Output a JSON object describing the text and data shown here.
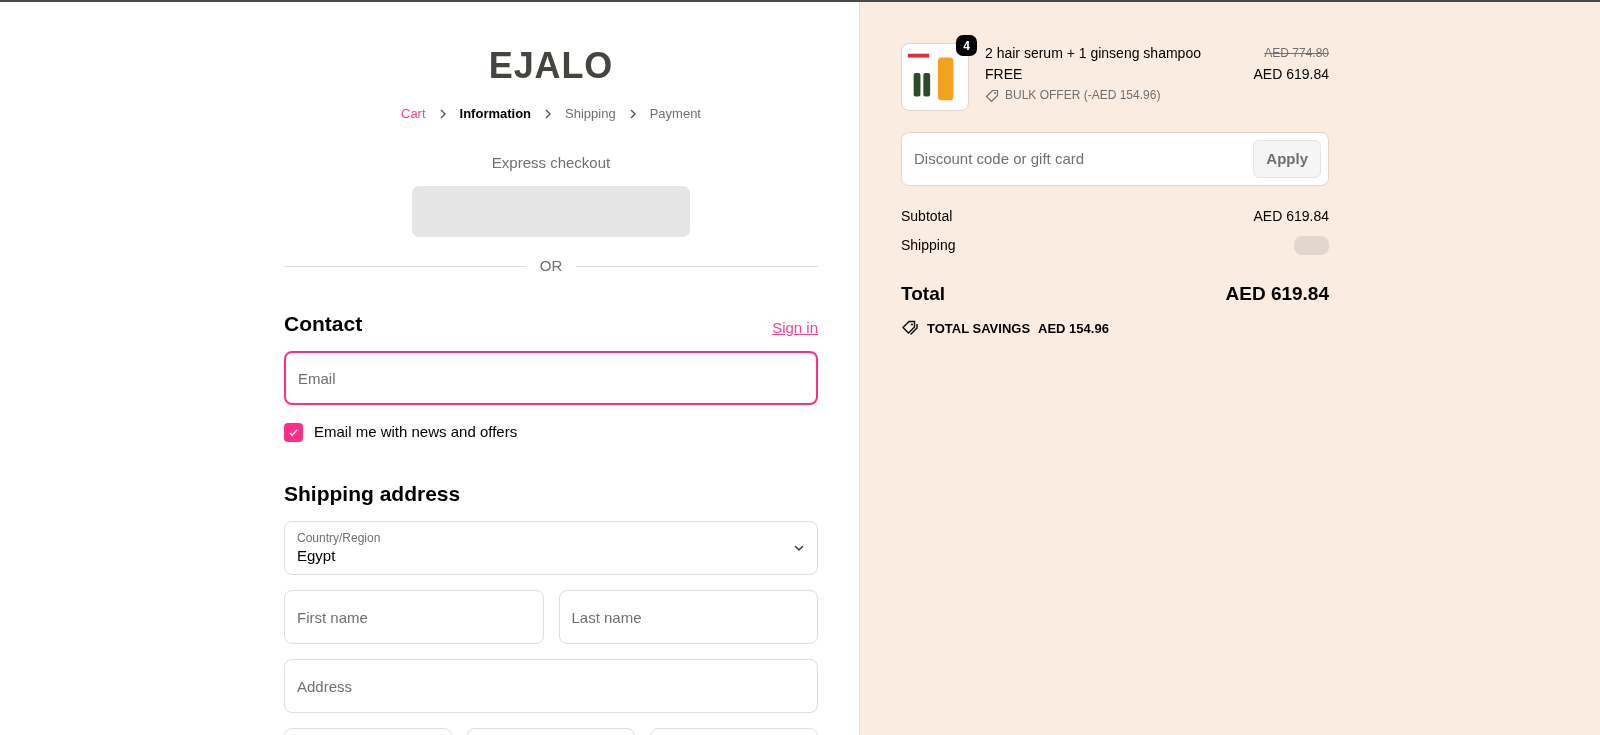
{
  "logo": "EJALO",
  "breadcrumb": [
    {
      "label": "Cart",
      "kind": "done"
    },
    {
      "label": "Information",
      "kind": "current"
    },
    {
      "label": "Shipping",
      "kind": "pending"
    },
    {
      "label": "Payment",
      "kind": "pending"
    }
  ],
  "express_checkout": {
    "title": "Express checkout"
  },
  "divider": "OR",
  "contact": {
    "title": "Contact",
    "sign_in": "Sign in",
    "email": {
      "placeholder": "Email",
      "focused": true
    },
    "newsletter": {
      "label": "Email me with news and offers",
      "checked": true
    }
  },
  "shipping_address": {
    "title": "Shipping address",
    "country": {
      "label": "Country/Region",
      "value": "Egypt"
    },
    "field_rows": [
      [
        {
          "placeholder": "First name"
        },
        {
          "placeholder": "Last name"
        }
      ],
      [
        {
          "placeholder": "Address"
        }
      ]
    ]
  },
  "order": {
    "item": {
      "quantity": "4",
      "title": "2 hair serum + 1 ginseng shampoo",
      "variant": "FREE",
      "discount": "BULK OFFER (-AED 154.96)",
      "original_price": "AED 774.80",
      "price": "AED 619.84"
    },
    "discount_field": {
      "placeholder": "Discount code or gift card",
      "button": "Apply"
    },
    "subtotal": {
      "label": "Subtotal",
      "value": "AED 619.84"
    },
    "shipping": {
      "label": "Shipping"
    },
    "total": {
      "label": "Total",
      "value": "AED 619.84"
    },
    "savings": {
      "label": "TOTAL SAVINGS",
      "value": "AED 154.96"
    }
  }
}
